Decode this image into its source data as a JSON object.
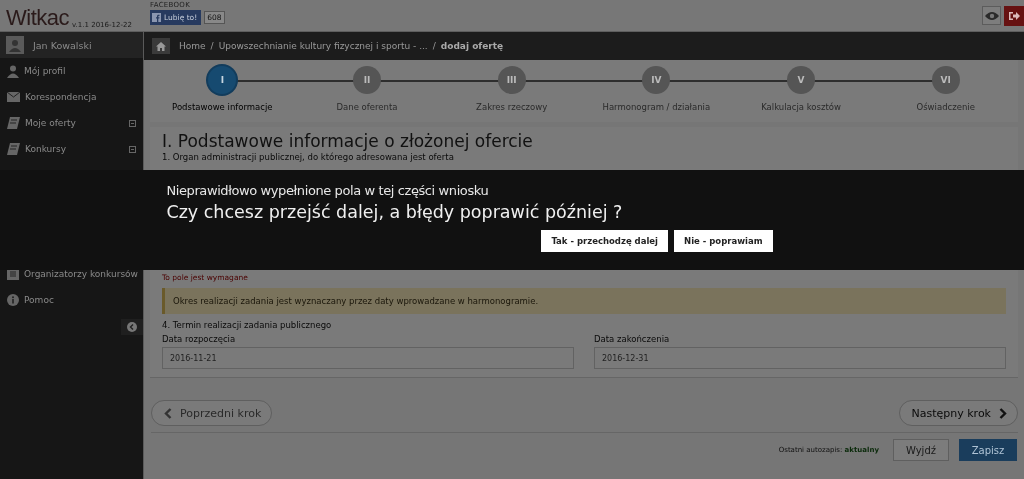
{
  "header": {
    "logo": "Witkac",
    "version": "v.1.1 2016-12-22",
    "facebook_label": "FACEBOOK",
    "like_button": "Lubię to!",
    "like_count": "608"
  },
  "sidebar": {
    "user": "Jan Kowalski",
    "items": [
      {
        "label": "Mój profil",
        "kind": "person",
        "collapsible": false
      },
      {
        "label": "Korespondencja",
        "kind": "mail",
        "collapsible": false
      },
      {
        "label": "Moje oferty",
        "kind": "book",
        "collapsible": true
      },
      {
        "label": "Konkursy",
        "kind": "book",
        "collapsible": true
      }
    ],
    "items_below": [
      {
        "label": "Organizatorzy konkursów",
        "kind": "list",
        "collapsible": false
      },
      {
        "label": "Pomoc",
        "kind": "info",
        "collapsible": false
      }
    ]
  },
  "breadcrumb": [
    {
      "label": "Home"
    },
    {
      "separator": "/",
      "label": "Upowszechnianie kultury fizycznej i sportu - ..."
    },
    {
      "separator": "/",
      "label": "dodaj ofertę"
    }
  ],
  "steps": [
    {
      "number": "I",
      "label": "Podstawowe informacje",
      "selected": true
    },
    {
      "number": "II",
      "label": "Dane oferenta",
      "selected": false
    },
    {
      "number": "III",
      "label": "Zakres rzeczowy",
      "selected": false
    },
    {
      "number": "IV",
      "label": "Harmonogram / działania",
      "selected": false
    },
    {
      "number": "V",
      "label": "Kalkulacja kosztów",
      "selected": false
    },
    {
      "number": "VI",
      "label": "Oświadczenie",
      "selected": false
    }
  ],
  "form": {
    "title": "I. Podstawowe informacje o złożonej ofercie",
    "question_1": "1. Organ administracji publicznej, do którego adresowana jest oferta",
    "error": "To pole jest wymagane",
    "alert": "Okres realizacji zadania jest wyznaczany przez daty wprowadzane w harmonogramie.",
    "question_4": "4. Termin realizacji zadania publicznego",
    "dates": [
      {
        "label": "Data rozpoczęcia",
        "value": "2016-11-21"
      },
      {
        "label": "Data zakończenia",
        "value": "2016-12-31"
      }
    ]
  },
  "navigation": {
    "previous": "Poprzedni krok",
    "next": "Następny krok"
  },
  "footer": {
    "autosave": "Ostatni autozapis: **aktualny**",
    "exit": "Wyjdź",
    "save": "Zapisz"
  },
  "dialog": {
    "message": "Nieprawidłowo wypełnione pola w tej części wniosku",
    "question": "Czy chcesz przejść dalej, a błędy poprawić później ?",
    "buttons": [
      "Tak - przechodzę dalej",
      "Nie - poprawiam"
    ]
  }
}
